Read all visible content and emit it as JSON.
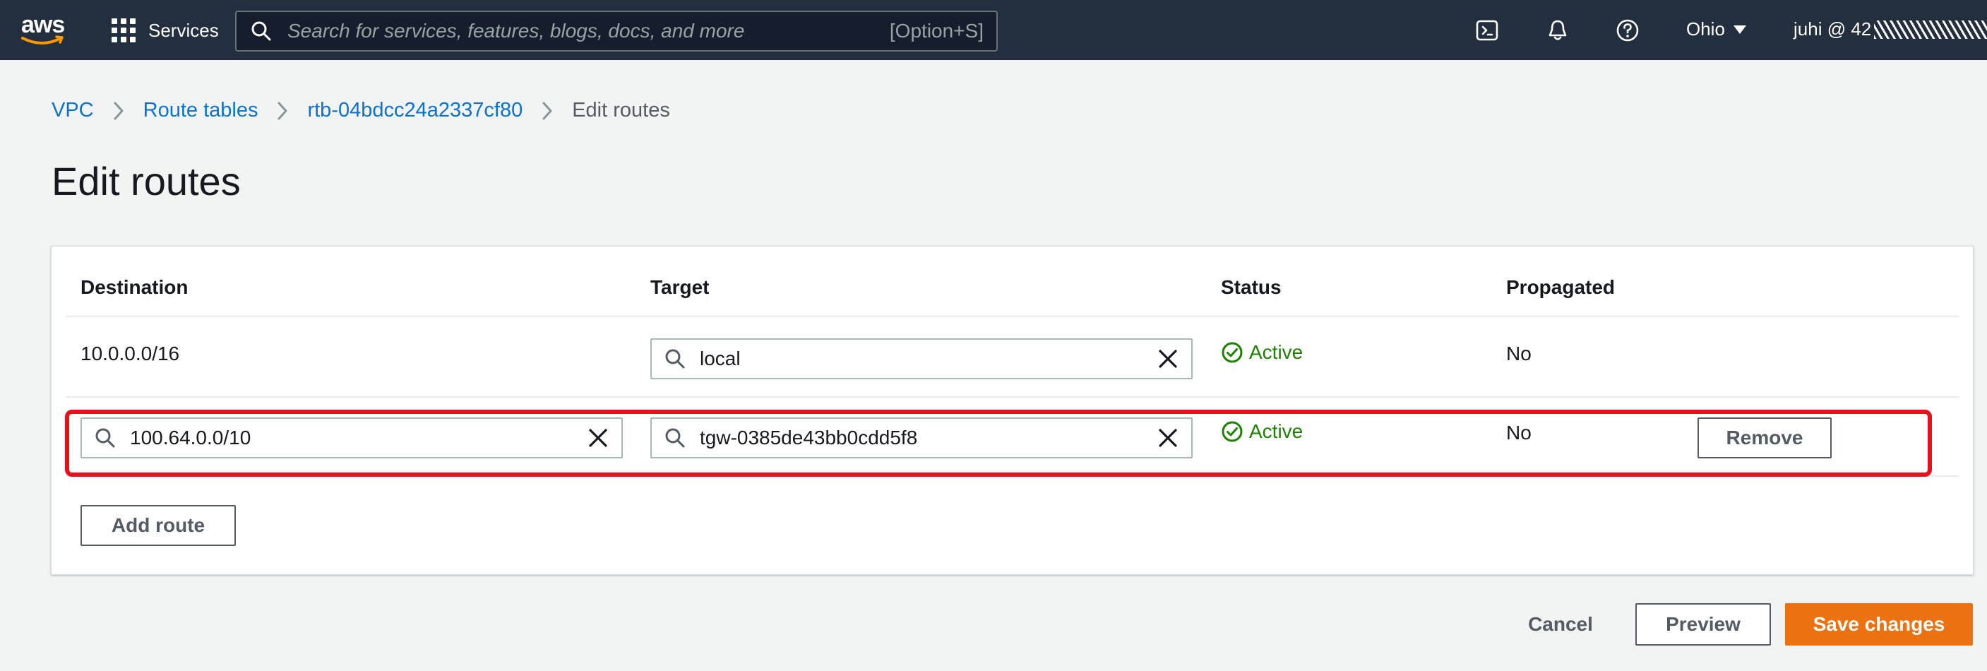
{
  "topnav": {
    "logo_text": "aws",
    "services_label": "Services",
    "search_placeholder": "Search for services, features, blogs, docs, and more",
    "search_shortcut": "[Option+S]",
    "icons": [
      "cloudshell-icon",
      "bell-icon",
      "help-icon"
    ],
    "region_label": "Ohio",
    "account_label": "juhi @ 42"
  },
  "breadcrumb": {
    "items": [
      "VPC",
      "Route tables",
      "rtb-04bdcc24a2337cf80"
    ],
    "current": "Edit routes"
  },
  "page_title": "Edit routes",
  "table": {
    "headers": {
      "destination": "Destination",
      "target": "Target",
      "status": "Status",
      "propagated": "Propagated"
    },
    "rows": [
      {
        "destination": "10.0.0.0/16",
        "target": "local",
        "status": "Active",
        "propagated": "No"
      },
      {
        "destination": "100.64.0.0/10",
        "target": "tgw-0385de43bb0cdd5f8",
        "status": "Active",
        "propagated": "No",
        "remove_label": "Remove"
      }
    ],
    "add_route_label": "Add route"
  },
  "footer": {
    "cancel_label": "Cancel",
    "preview_label": "Preview",
    "save_label": "Save changes"
  },
  "colors": {
    "nav_bg": "#232f3e",
    "link": "#0972d3",
    "status_success": "#1d8102",
    "primary_button": "#ec7211",
    "highlight": "#e8101b"
  }
}
